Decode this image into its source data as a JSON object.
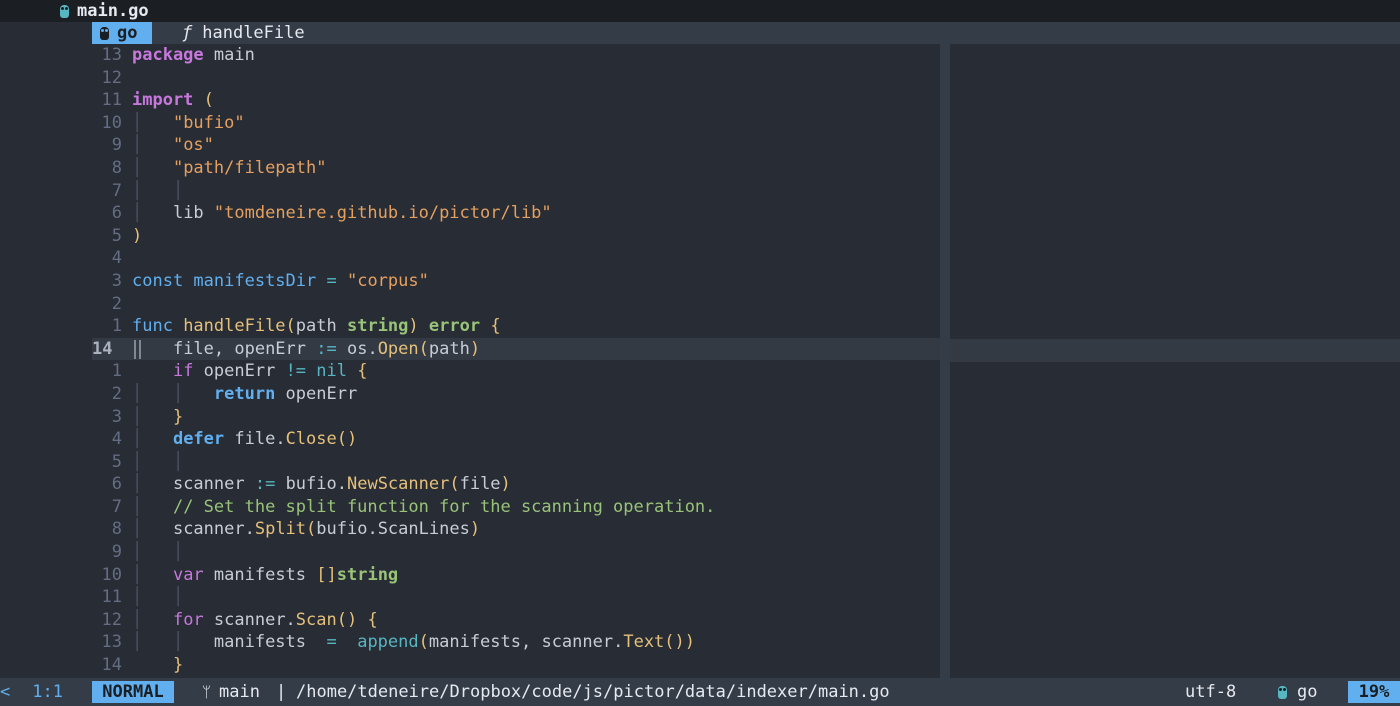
{
  "tab": {
    "filename": "main.go",
    "icon": "gopher-icon"
  },
  "winbar": {
    "filetype": "go",
    "func_symbol": "ƒ",
    "func_name": "handleFile"
  },
  "code": {
    "lines": [
      {
        "num": "13",
        "html_key": "l_package"
      },
      {
        "num": "12"
      },
      {
        "num": "11"
      },
      {
        "num": "10"
      },
      {
        "num": "9"
      },
      {
        "num": "8"
      },
      {
        "num": "7"
      },
      {
        "num": "6"
      },
      {
        "num": "5"
      },
      {
        "num": "4"
      },
      {
        "num": "3"
      },
      {
        "num": "2"
      },
      {
        "num": "1"
      },
      {
        "num": "14",
        "current": true
      },
      {
        "num": "1"
      },
      {
        "num": "2"
      },
      {
        "num": "3"
      },
      {
        "num": "4"
      },
      {
        "num": "5"
      },
      {
        "num": "6"
      },
      {
        "num": "7"
      },
      {
        "num": "8"
      },
      {
        "num": "9"
      },
      {
        "num": "10"
      },
      {
        "num": "11"
      },
      {
        "num": "12"
      },
      {
        "num": "13"
      },
      {
        "num": "14"
      }
    ],
    "tokens": {
      "package": "package",
      "main": " main",
      "import": "import",
      "lparen": " (",
      "bufio_str": "\"bufio\"",
      "os_str": "\"os\"",
      "fp_str": "\"path/filepath\"",
      "lib": "lib ",
      "lib_str": "\"tomdeneire.github.io/pictor/lib\"",
      "rparen": ")",
      "const": "const",
      "manifestsDir": " manifestsDir",
      "eq": " = ",
      "corpus": "\"corpus\"",
      "func": "func",
      "handleFile": " handleFile",
      "sig_open": "(",
      "path": "path ",
      "string": "string",
      "sig_close": ")",
      "error": " error",
      "brace_open": " {",
      "file_openErr": "file, openErr ",
      "assign": ":=",
      "os_dot": " os.",
      "Open": "Open",
      "o_paren": "(",
      "path_arg": "path",
      "c_paren": ")",
      "if": "if",
      "openErr_cmp": " openErr ",
      "neq": "!=",
      "nil": " nil",
      "ob": " {",
      "return": "return",
      "openErr_ret": " openErr",
      "cb": "}",
      "defer": "defer",
      "file_dot": " file.",
      "Close": "Close",
      "unit": "()",
      "scanner": "scanner ",
      "bufio_dot": " bufio.",
      "NewScanner": "NewScanner",
      "file_arg": "file",
      "comment": "// Set the split function for the scanning operation.",
      "scanner_dot": "scanner.",
      "Split": "Split",
      "bufio_scanlines": "bufio.ScanLines",
      "var": "var",
      "manifests": " manifests ",
      "slice": "[]",
      "string2": "string",
      "for": "for",
      "scanner_dot2": " scanner.",
      "Scan": "Scan",
      "manifests_lhs": "manifests ",
      "append": " append",
      "append_args": "manifests, scanner.",
      "Text": "Text"
    }
  },
  "status": {
    "left_arrow": "<",
    "cursor_pos": "1:1",
    "mode": "NORMAL",
    "branch_icon": "git-branch-icon",
    "branch": "main",
    "separator": "|",
    "path": "/home/tdeneire/Dropbox/code/js/pictor/data/indexer/main.go",
    "encoding": "utf-8",
    "filetype": "go",
    "percent": "19%"
  }
}
